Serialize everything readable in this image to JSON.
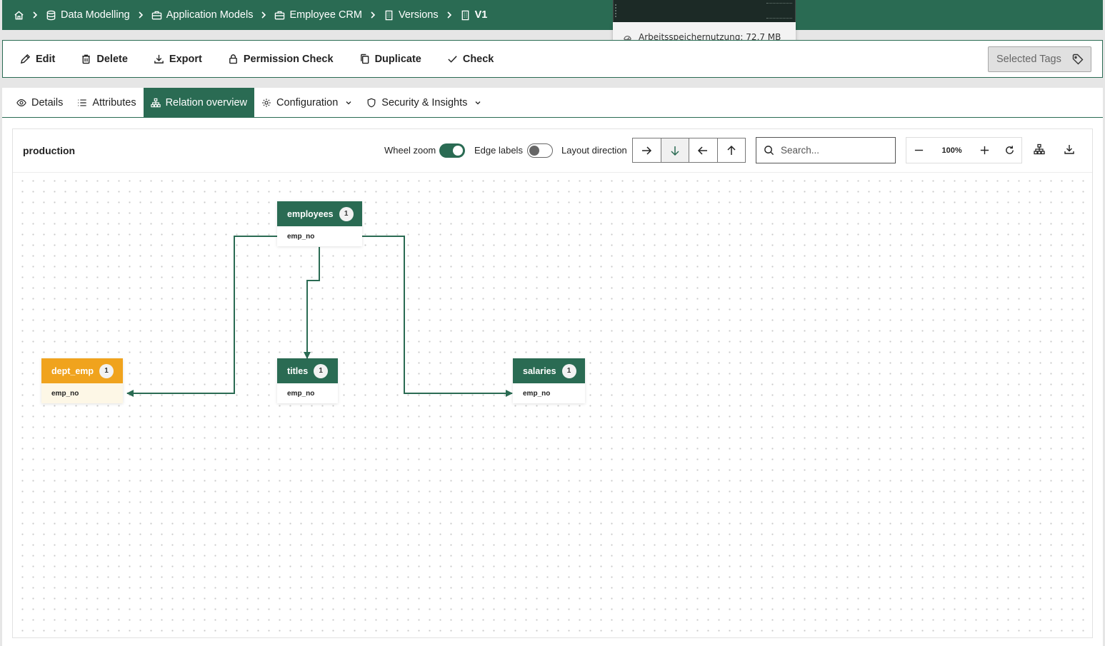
{
  "breadcrumb": {
    "items": [
      {
        "label": "Data Modelling",
        "icon": "database-icon"
      },
      {
        "label": "Application Models",
        "icon": "briefcase-icon"
      },
      {
        "label": "Employee CRM",
        "icon": "briefcase-icon"
      },
      {
        "label": "Versions",
        "icon": "building-icon"
      },
      {
        "label": "V1",
        "icon": "building-icon"
      }
    ]
  },
  "tooltip": {
    "text": "Arbeitsspeichernutzung: 72,7 MB"
  },
  "toolbar": {
    "edit": "Edit",
    "delete": "Delete",
    "export": "Export",
    "permission_check": "Permission Check",
    "duplicate": "Duplicate",
    "check": "Check",
    "selected_tags": "Selected Tags"
  },
  "tabs": {
    "details": "Details",
    "attributes": "Attributes",
    "relation_overview": "Relation overview",
    "configuration": "Configuration",
    "security": "Security & Insights"
  },
  "panel": {
    "title": "production",
    "wheel_zoom_label": "Wheel zoom",
    "wheel_zoom_on": true,
    "edge_labels_label": "Edge labels",
    "edge_labels_on": false,
    "layout_direction_label": "Layout direction",
    "layout_direction_selected": "down",
    "search_placeholder": "Search...",
    "zoom_value": "100%"
  },
  "nodes": {
    "employees": {
      "name": "employees",
      "count": "1",
      "field": "emp_no",
      "color": "#2a6b53"
    },
    "dept_emp": {
      "name": "dept_emp",
      "count": "1",
      "field": "emp_no",
      "color": "#f0a31d"
    },
    "titles": {
      "name": "titles",
      "count": "1",
      "field": "emp_no",
      "color": "#2a6b53"
    },
    "salaries": {
      "name": "salaries",
      "count": "1",
      "field": "emp_no",
      "color": "#2a6b53"
    }
  },
  "colors": {
    "brand": "#2a6b53",
    "highlight": "#f0a31d"
  }
}
